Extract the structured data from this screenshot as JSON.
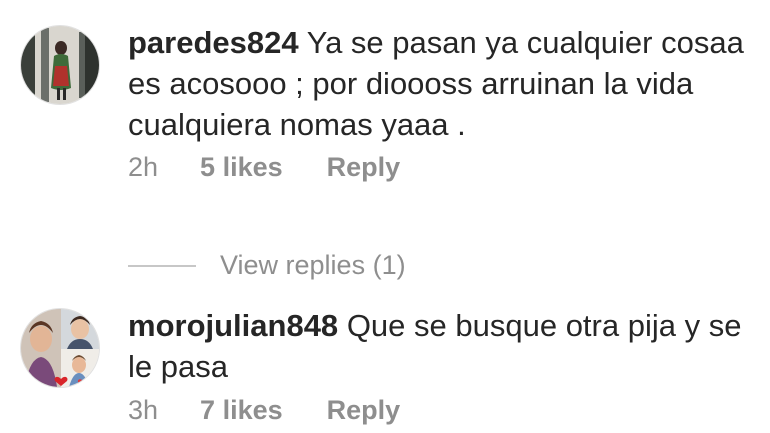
{
  "comments": [
    {
      "username": "paredes824",
      "text": "Ya se pasan ya cualquier cosaa es acosooo ; por dioooss arruinan la vida  cualquiera nomas yaaa .",
      "time": "2h",
      "likes": "5 likes",
      "reply": "Reply",
      "avatar_icon": "portrait-avatar-icon"
    },
    {
      "username": "morojulian848",
      "text": "Que se busque otra pija y se le pasa",
      "time": "3h",
      "likes": "7 likes",
      "reply": "Reply",
      "avatar_icon": "collage-avatar-icon"
    }
  ],
  "view_replies": "View replies (1)",
  "colors": {
    "primary_text": "#262626",
    "secondary_text": "#8e8e8e",
    "divider": "#c7c7c7"
  }
}
